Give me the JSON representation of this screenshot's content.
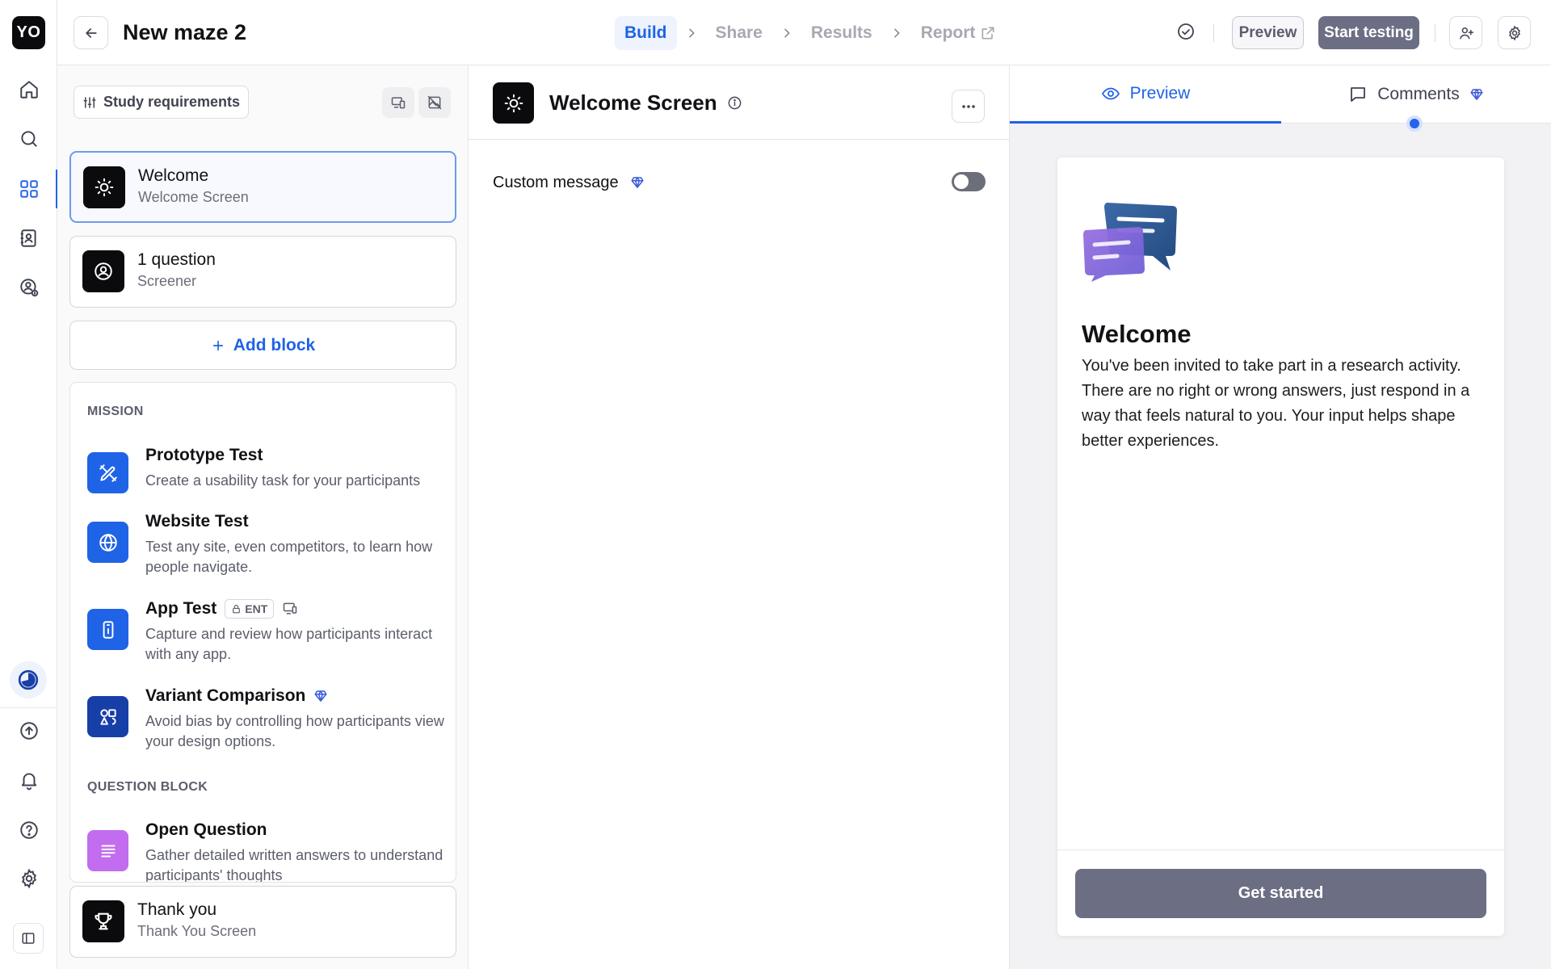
{
  "app": {
    "logo_text": "YO"
  },
  "header": {
    "title": "New maze 2",
    "steps": [
      {
        "label": "Build",
        "active": true
      },
      {
        "label": "Share",
        "active": false
      },
      {
        "label": "Results",
        "active": false
      },
      {
        "label": "Report",
        "active": false
      }
    ],
    "preview_label": "Preview",
    "start_label": "Start testing"
  },
  "left_panel": {
    "requirements_label": "Study requirements",
    "blocks": [
      {
        "title": "Welcome",
        "subtitle": "Welcome Screen",
        "icon": "sun-icon",
        "selected": true
      },
      {
        "title": "1 question",
        "subtitle": "Screener",
        "icon": "user-circle-icon",
        "selected": false
      }
    ],
    "add_block_label": "Add block",
    "library": {
      "mission_heading": "MISSION",
      "mission_items": [
        {
          "title": "Prototype Test",
          "desc": "Create a usability task for your participants",
          "icon": "pen-ruler-icon",
          "color": "#1f63e6"
        },
        {
          "title": "Website Test",
          "desc": "Test any site, even competitors, to learn how people navigate.",
          "icon": "globe-icon",
          "color": "#1f63e6"
        },
        {
          "title": "App Test",
          "badge": "ENT",
          "desc": "Capture and review how participants interact with any app.",
          "icon": "phone-icon",
          "color": "#1f63e6"
        },
        {
          "title": "Variant Comparison",
          "desc": "Avoid bias by controlling how participants view your design options.",
          "icon": "shapes-icon",
          "color": "#173fa8"
        }
      ],
      "question_heading": "QUESTION BLOCK",
      "question_items": [
        {
          "title": "Open Question",
          "desc": "Gather detailed written answers to understand participants' thoughts",
          "icon": "text-lines-icon",
          "color": "#c26cf0"
        }
      ]
    },
    "thank_you": {
      "title": "Thank you",
      "subtitle": "Thank You Screen",
      "icon": "trophy-icon"
    }
  },
  "center": {
    "title": "Welcome Screen",
    "custom_message_label": "Custom message",
    "custom_message_enabled": false
  },
  "right": {
    "tabs": [
      {
        "label": "Preview",
        "active": true
      },
      {
        "label": "Comments",
        "active": false
      }
    ],
    "preview": {
      "title": "Welcome",
      "body": "You've been invited to take part in a research activity. There are no right or wrong answers, just respond in a way that feels natural to you. Your input helps shape better experiences.",
      "button_label": "Get started"
    }
  },
  "colors": {
    "accent": "#1f63e6",
    "primary_button": "#6c6e84",
    "premium": "#3a5bd9"
  }
}
